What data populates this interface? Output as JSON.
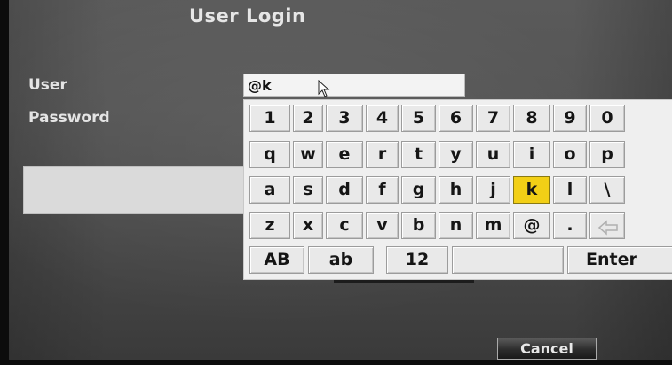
{
  "dialog": {
    "title": "User Login"
  },
  "form": {
    "user_label": "User",
    "password_label": "Password",
    "user_value": "@k",
    "password_value": ""
  },
  "keyboard": {
    "rows": [
      [
        "1",
        "2",
        "3",
        "4",
        "5",
        "6",
        "7",
        "8",
        "9",
        "0"
      ],
      [
        "q",
        "w",
        "e",
        "r",
        "t",
        "y",
        "u",
        "i",
        "o",
        "p"
      ],
      [
        "a",
        "s",
        "d",
        "f",
        "g",
        "h",
        "j",
        "k",
        "l",
        "\\"
      ],
      [
        "z",
        "x",
        "c",
        "v",
        "b",
        "n",
        "m",
        "@",
        ".",
        ""
      ]
    ],
    "selected_key": "k",
    "backspace_icon": "backspace-arrow-icon",
    "mode_keys": [
      "AB",
      "ab",
      "12"
    ],
    "space_label": "",
    "enter_label": "Enter",
    "highlight_color": "#f2cf16"
  },
  "buttons": {
    "cancel_label": "Cancel"
  }
}
